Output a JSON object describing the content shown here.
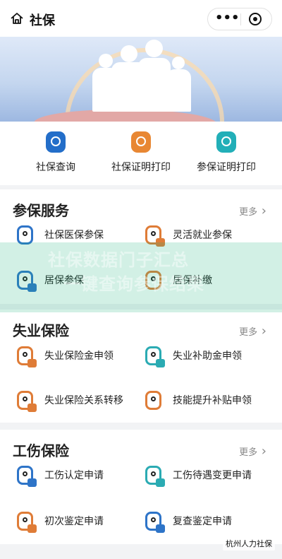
{
  "header": {
    "title": "社保",
    "home_icon": "home-icon",
    "more_icon": "more-icon",
    "target_icon": "target-icon"
  },
  "quick_actions": [
    {
      "label": "社保查询",
      "icon": "shield-search-icon",
      "color": "#236ec9"
    },
    {
      "label": "社保证明打印",
      "icon": "printer-icon",
      "color": "#e88733"
    },
    {
      "label": "参保证明打印",
      "icon": "certificate-icon",
      "color": "#22afb8"
    }
  ],
  "sections": [
    {
      "title": "参保服务",
      "more": "更多",
      "items": [
        {
          "label": "社保医保参保",
          "icon": "shield-person-icon",
          "color": "#2e74c8"
        },
        {
          "label": "灵活就业参保",
          "icon": "shield-card-icon",
          "color": "#df7c37"
        },
        {
          "label": "居保参保",
          "icon": "shield-card-icon",
          "color": "#2e74c8"
        },
        {
          "label": "居保补缴",
          "icon": "shield-person-icon",
          "color": "#df7c37"
        }
      ]
    },
    {
      "title": "失业保险",
      "more": "更多",
      "items": [
        {
          "label": "失业保险金申领",
          "icon": "shield-wallet-icon",
          "color": "#df7c37"
        },
        {
          "label": "失业补助金申领",
          "icon": "shield-wallet-icon",
          "color": "#2babb3"
        },
        {
          "label": "失业保险关系转移",
          "icon": "shield-wallet-icon",
          "color": "#df7c37"
        },
        {
          "label": "技能提升补贴申领",
          "icon": "shield-person-icon",
          "color": "#df7c37"
        }
      ]
    },
    {
      "title": "工伤保险",
      "more": "更多",
      "items": [
        {
          "label": "工伤认定申请",
          "icon": "shield-plus-icon",
          "color": "#2e74c8"
        },
        {
          "label": "工伤待遇变更申请",
          "icon": "shield-plus-icon",
          "color": "#2babb3"
        },
        {
          "label": "初次鉴定申请",
          "icon": "shield-plus-icon",
          "color": "#df7c37"
        },
        {
          "label": "复查鉴定申请",
          "icon": "shield-plus-icon",
          "color": "#2e74c8"
        }
      ]
    }
  ],
  "overlay": {
    "line1": "社保数据门子汇总",
    "line2": "一键查询参保结果"
  },
  "watermark": "杭州人力社保"
}
